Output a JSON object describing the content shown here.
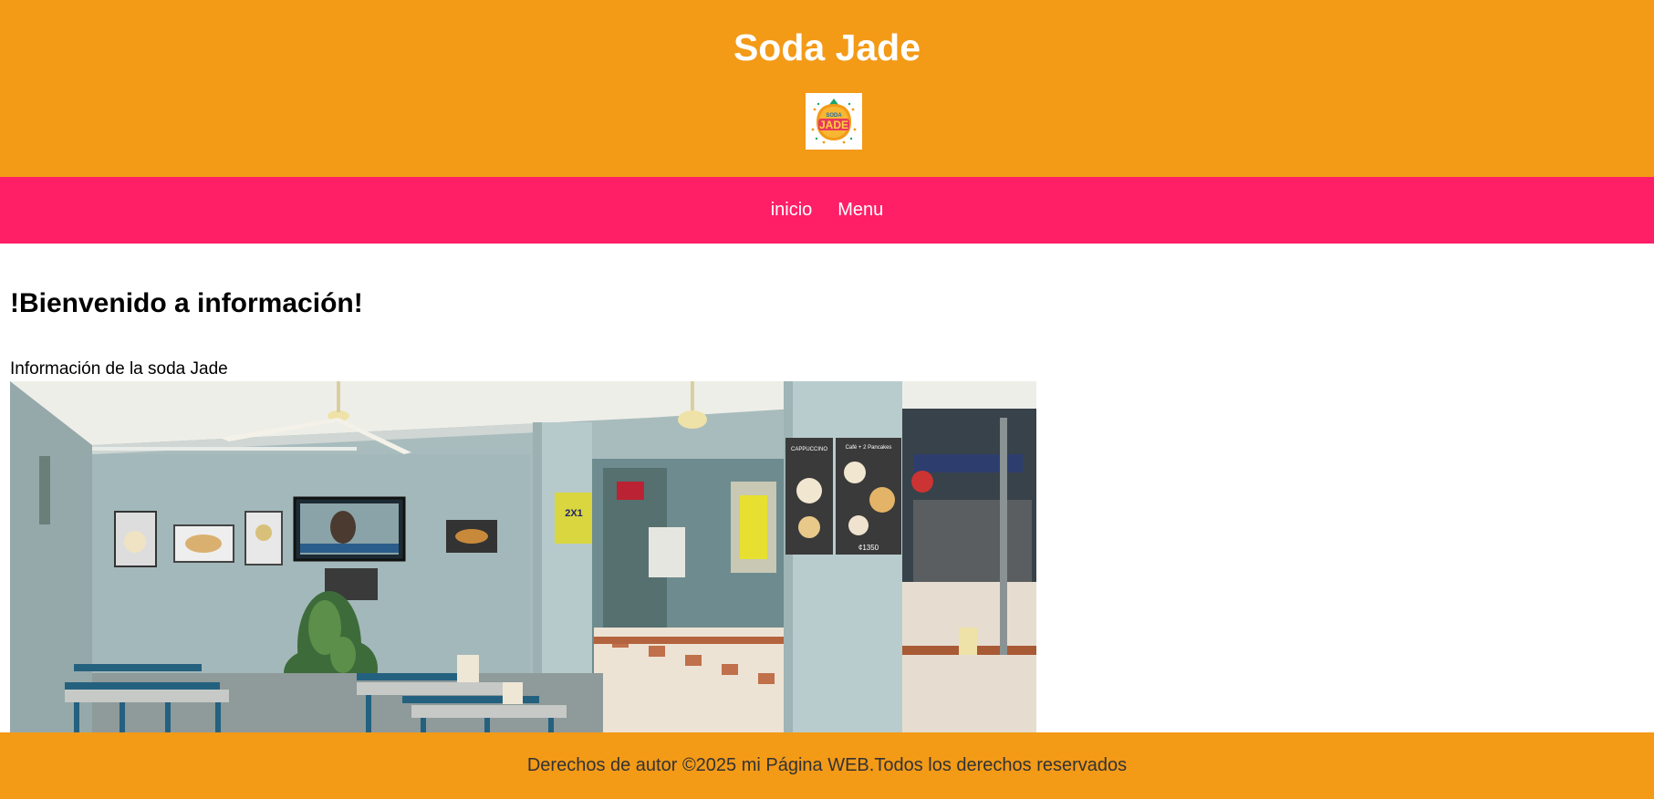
{
  "header": {
    "title": "Soda Jade",
    "logo": {
      "top_text": "SODA",
      "main_text": "JADE"
    }
  },
  "nav": {
    "items": [
      {
        "label": "inicio"
      },
      {
        "label": "Menu"
      }
    ]
  },
  "main": {
    "heading": "!Bienvenido a información!",
    "description": "Información de la soda Jade"
  },
  "photo": {
    "poster_2x1": "2X1",
    "menu_board_1": "CAPPUCCINO",
    "menu_board_2": "Café + 2 Pancakes",
    "price_2": "¢1350"
  },
  "footer": {
    "text": "Derechos de autor ©2025 mi Página WEB.Todos los derechos reservados"
  },
  "colors": {
    "header_bg": "#f39a17",
    "nav_bg": "#ff1f66",
    "footer_bg": "#f39a17",
    "text_white": "#ffffff"
  }
}
